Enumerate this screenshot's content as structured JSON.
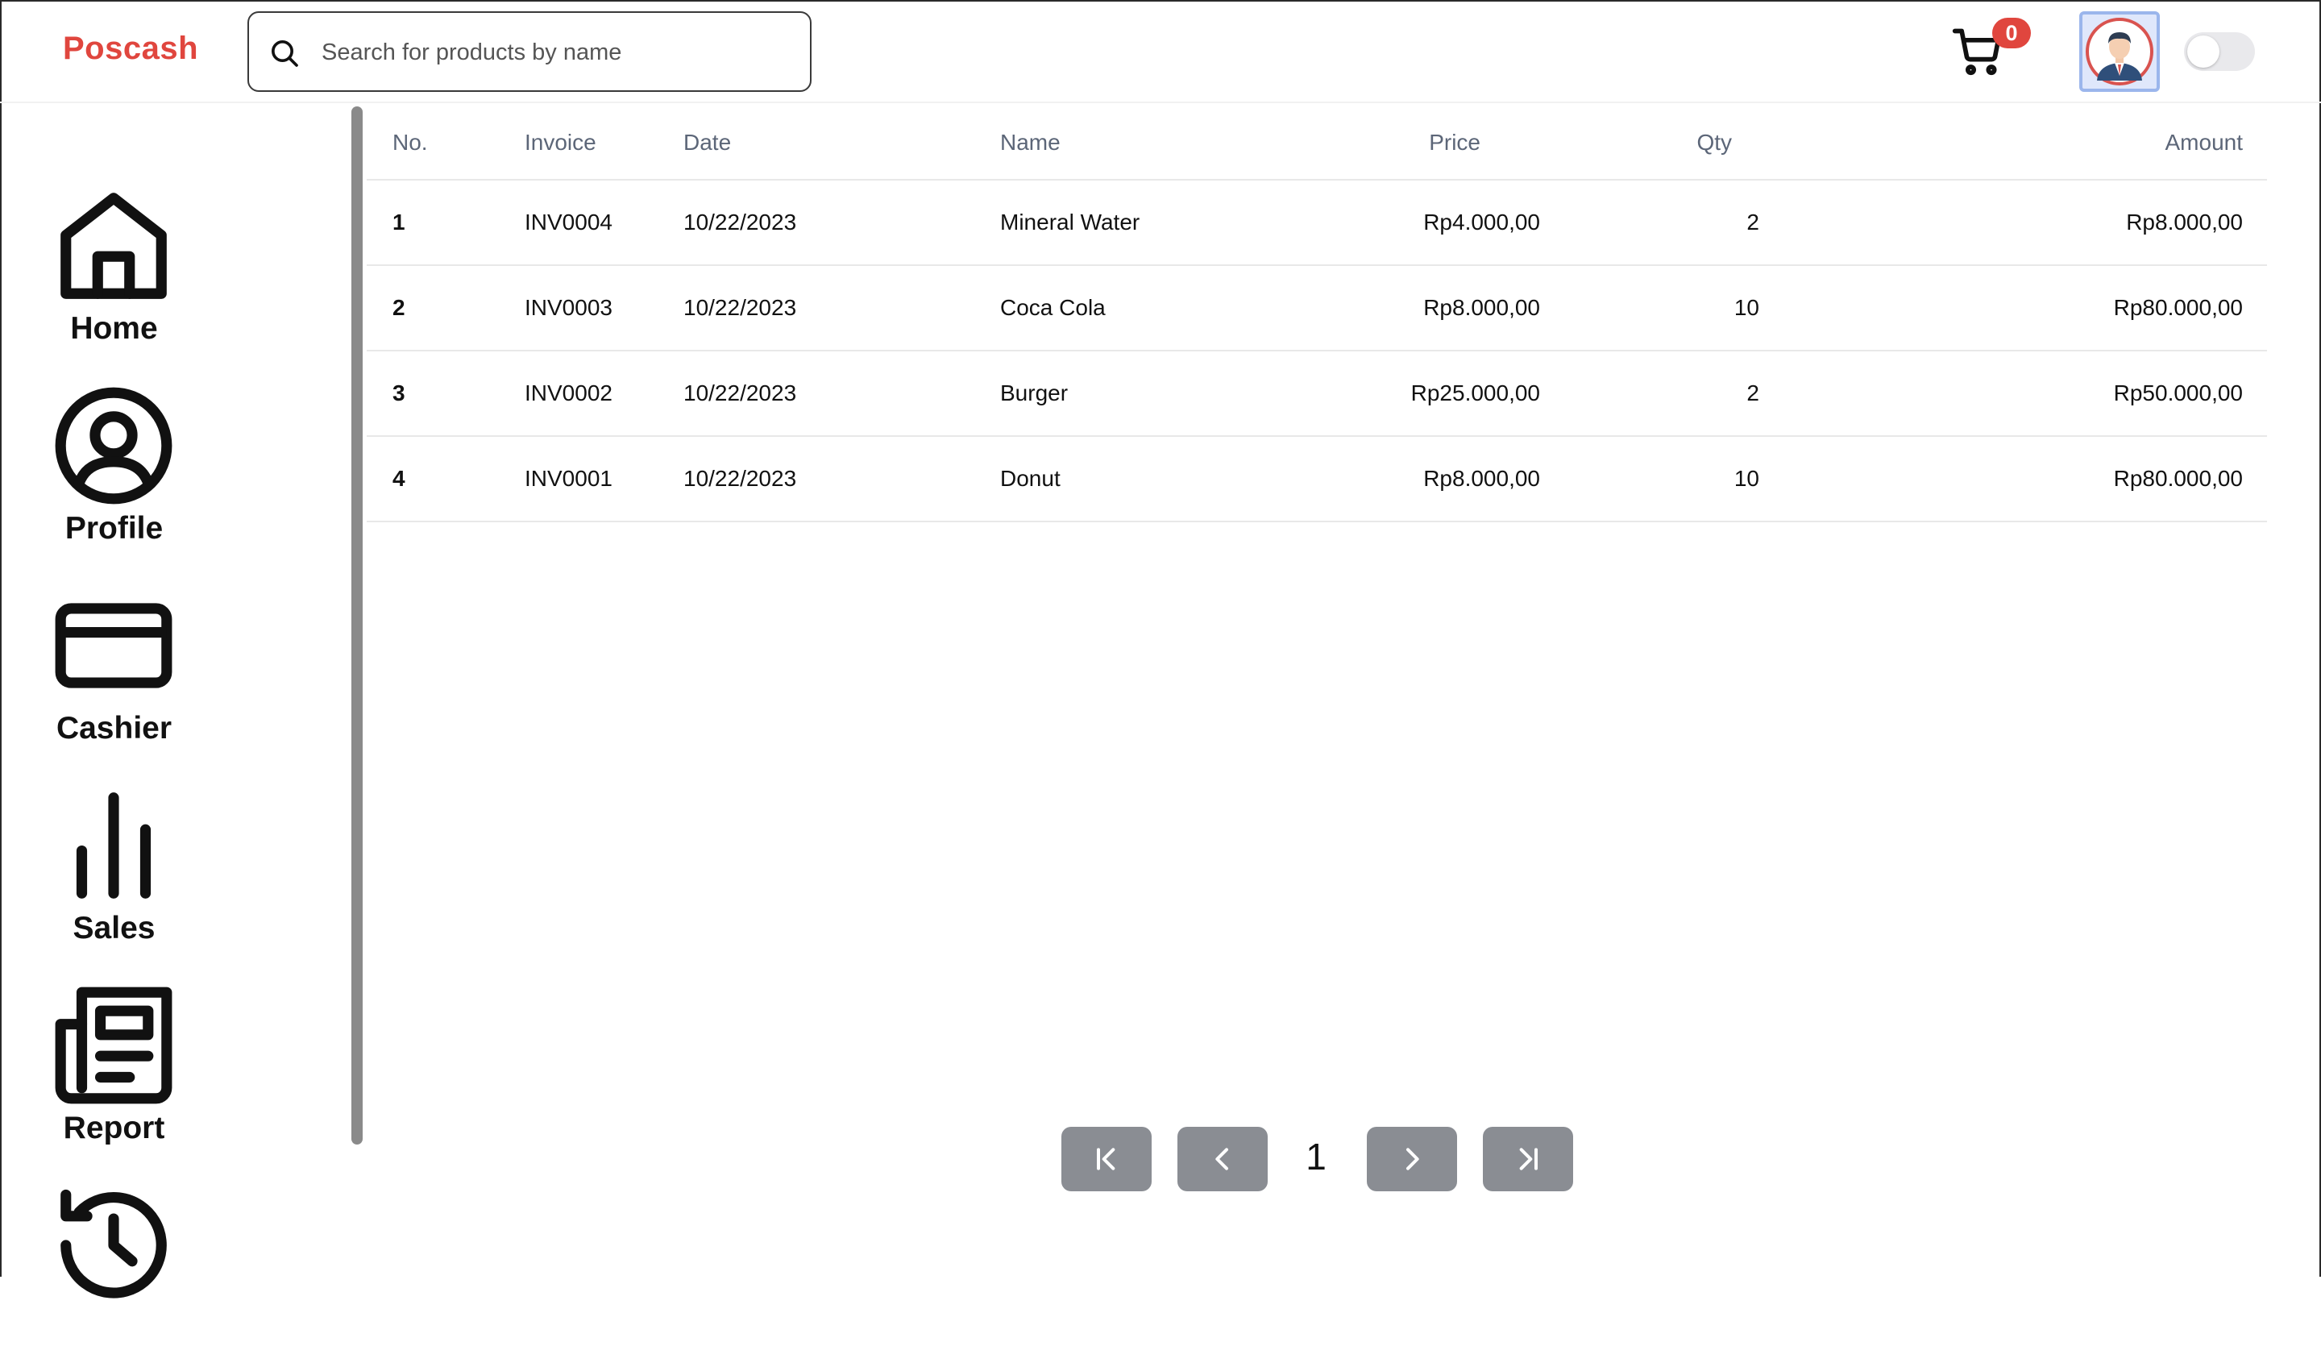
{
  "app": {
    "brand": "Poscash"
  },
  "search": {
    "placeholder": "Search for products by name",
    "value": ""
  },
  "cart": {
    "count": "0"
  },
  "sidebar": {
    "items": [
      {
        "label": "Home",
        "icon": "home-icon"
      },
      {
        "label": "Profile",
        "icon": "user-circle-icon"
      },
      {
        "label": "Cashier",
        "icon": "credit-card-icon"
      },
      {
        "label": "Sales",
        "icon": "bar-chart-icon"
      },
      {
        "label": "Report",
        "icon": "newspaper-icon"
      },
      {
        "label": "",
        "icon": "history-icon"
      }
    ]
  },
  "table": {
    "headers": [
      "No.",
      "Invoice",
      "Date",
      "Name",
      "Price",
      "Qty",
      "Amount"
    ],
    "rows": [
      [
        "1",
        "INV0004",
        "10/22/2023",
        "Mineral Water",
        "Rp4.000,00",
        "2",
        "Rp8.000,00"
      ],
      [
        "2",
        "INV0003",
        "10/22/2023",
        "Coca Cola",
        "Rp8.000,00",
        "10",
        "Rp80.000,00"
      ],
      [
        "3",
        "INV0002",
        "10/22/2023",
        "Burger",
        "Rp25.000,00",
        "2",
        "Rp50.000,00"
      ],
      [
        "4",
        "INV0001",
        "10/22/2023",
        "Donut",
        "Rp8.000,00",
        "10",
        "Rp80.000,00"
      ]
    ]
  },
  "pagination": {
    "current_page": "1"
  },
  "colors": {
    "brand": "#e0463e",
    "badge": "#e0463e",
    "pagination_button": "#8a8d93",
    "header_text": "#5c6678"
  }
}
